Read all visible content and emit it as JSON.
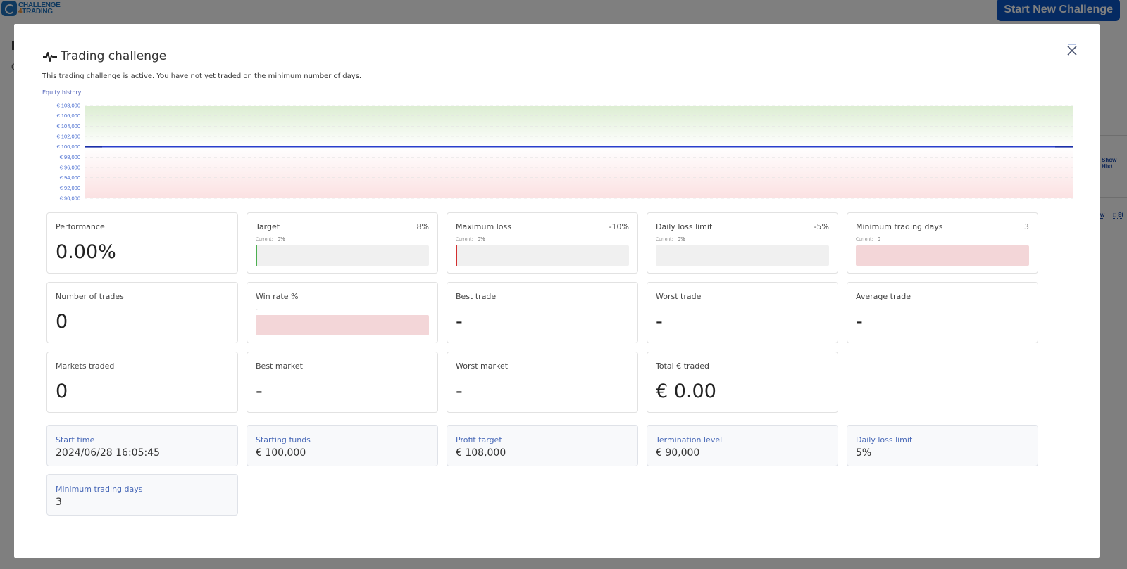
{
  "background": {
    "logo": {
      "line1": "CHALLENGE",
      "line2_num": "4",
      "line2_text": "TRADING"
    },
    "start_button": "Start New Challenge",
    "side_links": [
      "Show Hist",
      "w",
      "St"
    ]
  },
  "modal": {
    "title": "Trading challenge",
    "title_icon": "activity-pulse-icon",
    "close_icon": "close-icon",
    "status_text": "This trading challenge is active. You have not yet traded on the minimum number of days.",
    "chart_label": "Equity history"
  },
  "chart_data": {
    "type": "line",
    "title": "Equity history",
    "xlabel": "",
    "ylabel": "",
    "ylim": [
      90000,
      108000
    ],
    "y_ticks": [
      108000,
      106000,
      104000,
      102000,
      100000,
      98000,
      96000,
      94000,
      92000,
      90000
    ],
    "y_tick_labels": [
      "€ 108,000",
      "€ 106,000",
      "€ 104,000",
      "€ 102,000",
      "€ 100,000",
      "€ 98,000",
      "€ 96,000",
      "€ 94,000",
      "€ 92,000",
      "€ 90,000"
    ],
    "grid": true,
    "bands": [
      {
        "name": "profit-zone",
        "from": 100000,
        "to": 108000,
        "color": "#dcedd2"
      },
      {
        "name": "loss-zone",
        "from": 90000,
        "to": 100000,
        "color": "#fbe1e2"
      }
    ],
    "series": [
      {
        "name": "Equity",
        "x": [
          0,
          1
        ],
        "values": [
          100000,
          100000
        ],
        "color": "#2a3fcc"
      }
    ],
    "legend": "none"
  },
  "metrics": [
    {
      "label": "Performance",
      "value": "0.00%"
    },
    {
      "label": "Target",
      "target": "8%",
      "current_label": "Current:",
      "current": "0%",
      "progress": 0,
      "marker_color": "#4caf50",
      "bar": "grey"
    },
    {
      "label": "Maximum loss",
      "target": "-10%",
      "current_label": "Current:",
      "current": "0%",
      "progress": 0,
      "marker_color": "#d32f2f",
      "bar": "grey"
    },
    {
      "label": "Daily loss limit",
      "target": "-5%",
      "current_label": "Current:",
      "current": "0%",
      "progress": 0,
      "bar": "grey"
    },
    {
      "label": "Minimum trading days",
      "target": "3",
      "current_label": "Current:",
      "current": "0",
      "progress": 0,
      "bar": "pink"
    },
    {
      "label": "Number of trades",
      "value": "0"
    },
    {
      "label": "Win rate %",
      "current": "-",
      "bar": "pink"
    },
    {
      "label": "Best trade",
      "value": "-"
    },
    {
      "label": "Worst trade",
      "value": "-"
    },
    {
      "label": "Average trade",
      "value": "-"
    },
    {
      "label": "Markets traded",
      "value": "0"
    },
    {
      "label": "Best market",
      "value": "-"
    },
    {
      "label": "Worst market",
      "value": "-"
    },
    {
      "label": "Total € traded",
      "value": "€ 0.00"
    }
  ],
  "details": [
    {
      "label": "Start time",
      "value": "2024/06/28 16:05:45"
    },
    {
      "label": "Starting funds",
      "value": "€ 100,000"
    },
    {
      "label": "Profit target",
      "value": "€ 108,000"
    },
    {
      "label": "Termination level",
      "value": "€ 90,000"
    },
    {
      "label": "Daily loss limit",
      "value": "5%"
    },
    {
      "label": "Minimum trading days",
      "value": "3"
    }
  ]
}
